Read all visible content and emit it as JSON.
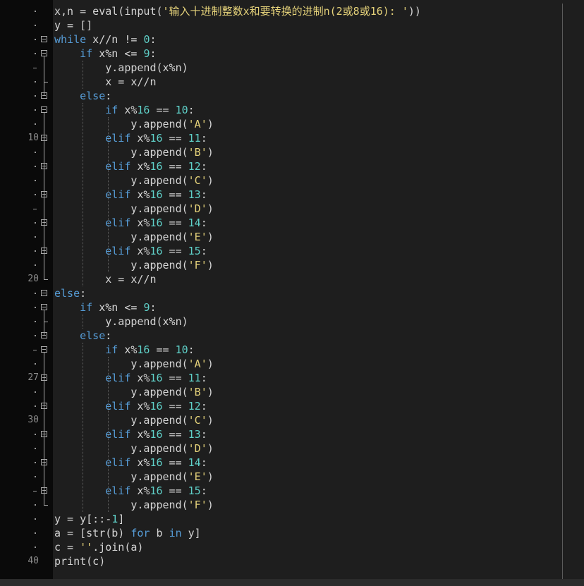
{
  "editor": {
    "language": "python",
    "colors": {
      "background": "#1e1e1e",
      "gutter": "#0a0a0a",
      "keyword": "#569cd6",
      "number": "#5fd0c8",
      "string": "#e5d27a",
      "text": "#d4d4d4"
    },
    "line_numbers": [
      {
        "row": 9,
        "label": "10"
      },
      {
        "row": 19,
        "label": "20"
      },
      {
        "row": 26,
        "label": "27"
      },
      {
        "row": 29,
        "label": "30"
      },
      {
        "row": 39,
        "label": "40"
      }
    ],
    "lines": [
      "x,n = eval(input('输入十进制整数x和要转换的进制n(2或8或16): '))",
      "y = []",
      "while x//n != 0:",
      "    if x%n <= 9:",
      "        y.append(x%n)",
      "        x = x//n",
      "    else:",
      "        if x%16 == 10:",
      "            y.append('A')",
      "        elif x%16 == 11:",
      "            y.append('B')",
      "        elif x%16 == 12:",
      "            y.append('C')",
      "        elif x%16 == 13:",
      "            y.append('D')",
      "        elif x%16 == 14:",
      "            y.append('E')",
      "        elif x%16 == 15:",
      "            y.append('F')",
      "        x = x//n",
      "else:",
      "    if x%n <= 9:",
      "        y.append(x%n)",
      "    else:",
      "        if x%16 == 10:",
      "            y.append('A')",
      "        elif x%16 == 11:",
      "            y.append('B')",
      "        elif x%16 == 12:",
      "            y.append('C')",
      "        elif x%16 == 13:",
      "            y.append('D')",
      "        elif x%16 == 14:",
      "            y.append('E')",
      "        elif x%16 == 15:",
      "            y.append('F')",
      "y = y[::-1]",
      "a = [str(b) for b in y]",
      "c = ''.join(a)",
      "print(c)"
    ]
  }
}
